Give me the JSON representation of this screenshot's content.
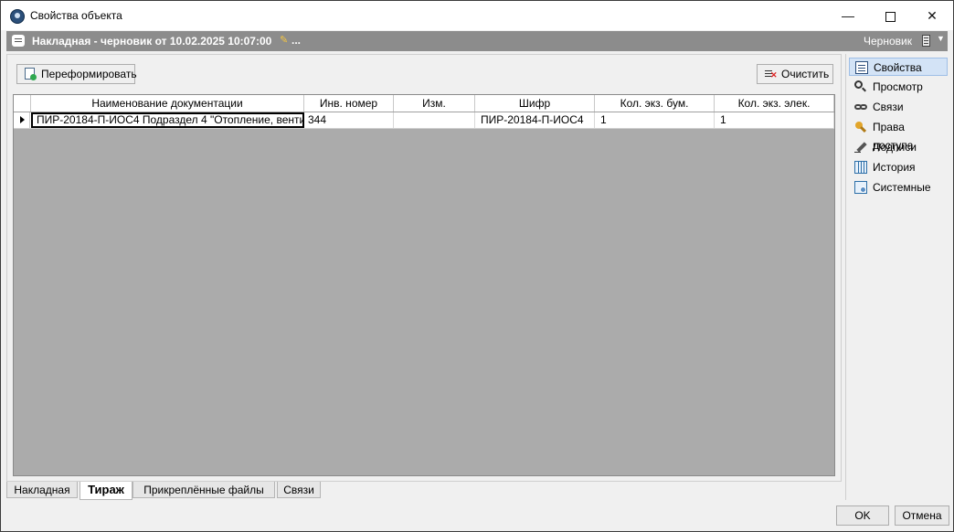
{
  "window": {
    "title": "Свойства объекта"
  },
  "header": {
    "title": "Накладная -  черновик от 10.02.2025 10:07:00",
    "ellipsis": "...",
    "status": "Черновик"
  },
  "toolbar": {
    "reformat_label": "Переформировать",
    "clear_label": "Очистить"
  },
  "grid": {
    "columns": [
      "Наименование документации",
      "Инв. номер",
      "Изм.",
      "Шифр",
      "Кол. экз. бум.",
      "Кол. экз. элек."
    ],
    "rows": [
      {
        "name": "ПИР-20184-П-ИОС4 Подраздел 4 \"Отопление, венти",
        "inv": "344",
        "rev": "",
        "code": "ПИР-20184-П-ИОС4",
        "paper": "1",
        "electronic": "1"
      }
    ]
  },
  "tabs": [
    "Накладная",
    "Тираж",
    "Прикреплённые файлы",
    "Связи"
  ],
  "active_tab": "Тираж",
  "sidebar": {
    "items": [
      {
        "label": "Свойства",
        "icon": "properties-icon"
      },
      {
        "label": "Просмотр",
        "icon": "magnifier-icon"
      },
      {
        "label": "Связи",
        "icon": "chain-icon"
      },
      {
        "label": "Права доступа",
        "icon": "key-icon"
      },
      {
        "label": "Подписи",
        "icon": "pen-icon"
      },
      {
        "label": "История",
        "icon": "history-icon"
      },
      {
        "label": "Системные",
        "icon": "system-icon"
      }
    ]
  },
  "footer": {
    "ok_label": "OK",
    "cancel_label": "Отмена"
  }
}
